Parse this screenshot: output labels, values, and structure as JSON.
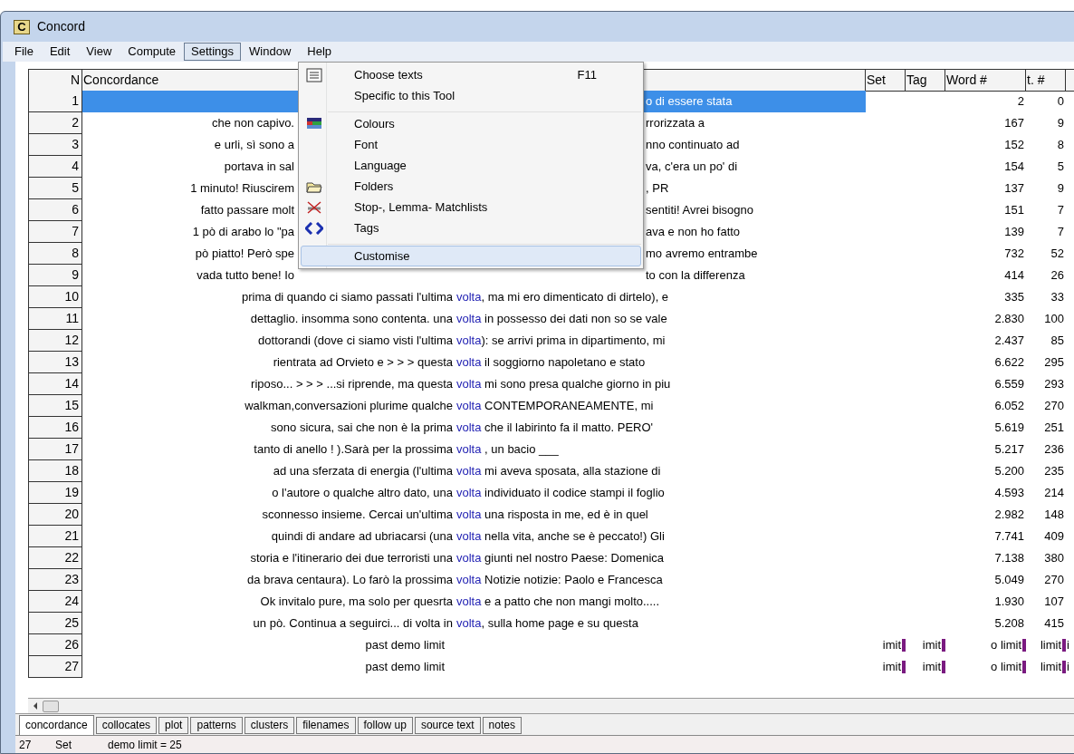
{
  "window": {
    "icon_letter": "C",
    "title": "Concord"
  },
  "menu_bar": [
    {
      "label": "File",
      "selected": false
    },
    {
      "label": "Edit",
      "selected": false
    },
    {
      "label": "View",
      "selected": false
    },
    {
      "label": "Compute",
      "selected": false
    },
    {
      "label": "Settings",
      "selected": true
    },
    {
      "label": "Window",
      "selected": false
    },
    {
      "label": "Help",
      "selected": false
    }
  ],
  "settings_menu": {
    "items": [
      {
        "kind": "item",
        "label": "Choose texts",
        "shortcut": "F11",
        "selected": false
      },
      {
        "kind": "item",
        "label": "Specific to this Tool",
        "selected": false
      },
      {
        "kind": "separator"
      },
      {
        "kind": "item",
        "label": "Colours",
        "selected": false
      },
      {
        "kind": "item",
        "label": "Font",
        "selected": false
      },
      {
        "kind": "item",
        "label": "Language",
        "selected": false
      },
      {
        "kind": "item",
        "label": "Folders",
        "selected": false
      },
      {
        "kind": "item",
        "label": "Stop-, Lemma-  Matchlists",
        "selected": false
      },
      {
        "kind": "item",
        "label": "Tags",
        "selected": false
      },
      {
        "kind": "separator"
      },
      {
        "kind": "item",
        "label": "Customise",
        "selected": true
      }
    ]
  },
  "table": {
    "columns": [
      "N",
      "Concordance",
      "Set",
      "Tag",
      "Word #",
      "t. #"
    ],
    "rows": [
      {
        "kind": "covered",
        "n": "1",
        "right": "o di essere stata",
        "word": "2",
        "t": "0",
        "selected": true
      },
      {
        "kind": "covered",
        "n": "2",
        "left": "che non capivo.",
        "right": "rrorizzata a",
        "word": "167",
        "t": "9",
        "selected": false
      },
      {
        "kind": "covered",
        "n": "3",
        "left": "e urli, sì sono a",
        "right": "nno continuato ad",
        "word": "152",
        "t": "8",
        "selected": false
      },
      {
        "kind": "covered",
        "n": "4",
        "left": "portava in sal",
        "right": "va, c'era un po' di",
        "word": "154",
        "t": "5",
        "selected": false
      },
      {
        "kind": "covered",
        "n": "5",
        "left": "1 minuto! Riuscirem",
        "right": ", PR",
        "word": "137",
        "t": "9",
        "selected": false
      },
      {
        "kind": "covered",
        "n": "6",
        "left": "fatto passare molt",
        "right": "sentiti! Avrei bisogno",
        "word": "151",
        "t": "7",
        "selected": false
      },
      {
        "kind": "covered",
        "n": "7",
        "left": "1 pò di arabo lo \"pa",
        "right": "ava e non ho fatto",
        "word": "139",
        "t": "7",
        "selected": false
      },
      {
        "kind": "covered",
        "n": "8",
        "left": "pò piatto! Però spe",
        "right": "mo avremo entrambe",
        "word": "732",
        "t": "52",
        "selected": false
      },
      {
        "kind": "covered",
        "n": "9",
        "left": "vada tutto bene! Io",
        "right": "to con la differenza",
        "word": "414",
        "t": "26",
        "selected": false
      },
      {
        "kind": "hit",
        "n": "10",
        "left": "prima di quando ci siamo passati l'ultima",
        "key": "volta",
        "right": ", ma mi ero dimenticato di dirtelo), e",
        "word": "335",
        "t": "33",
        "selected": false
      },
      {
        "kind": "hit",
        "n": "11",
        "left": "dettaglio. insomma sono contenta. una",
        "key": "volta",
        "right": " in possesso dei dati non so se vale",
        "word": "2.830",
        "t": "100",
        "selected": false
      },
      {
        "kind": "hit",
        "n": "12",
        "left": "dottorandi (dove ci siamo visti l'ultima",
        "key": "volta",
        "right": "): se arrivi prima in dipartimento, mi",
        "word": "2.437",
        "t": "85",
        "selected": false
      },
      {
        "kind": "hit",
        "n": "13",
        "left": "rientrata ad Orvieto e > > > questa",
        "key": "volta",
        "right": " il soggiorno napoletano e stato",
        "word": "6.622",
        "t": "295",
        "selected": false
      },
      {
        "kind": "hit",
        "n": "14",
        "left": "riposo... > > > ...si riprende, ma questa",
        "key": "volta",
        "right": " mi sono presa qualche giorno in piu",
        "word": "6.559",
        "t": "293",
        "selected": false
      },
      {
        "kind": "hit",
        "n": "15",
        "left": "walkman,conversazioni plurime qualche",
        "key": "volta",
        "right": " CONTEMPORANEAMENTE, mi",
        "word": "6.052",
        "t": "270",
        "selected": false
      },
      {
        "kind": "hit",
        "n": "16",
        "left": "sono sicura, sai che non è la prima",
        "key": "volta",
        "right": " che il labirinto fa il matto. PERO'",
        "word": "5.619",
        "t": "251",
        "selected": false
      },
      {
        "kind": "hit",
        "n": "17",
        "left": "tanto di anello ! ).Sarà per la prossima",
        "key": "volta",
        "right": " , un bacio ___",
        "word": "5.217",
        "t": "236",
        "selected": false
      },
      {
        "kind": "hit",
        "n": "18",
        "left": "ad una sferzata di energia (l'ultima",
        "key": "volta",
        "right": " mi aveva sposata, alla stazione di",
        "word": "5.200",
        "t": "235",
        "selected": false
      },
      {
        "kind": "hit",
        "n": "19",
        "left": "o l'autore o qualche altro dato, una",
        "key": "volta",
        "right": " individuato il codice stampi il foglio",
        "word": "4.593",
        "t": "214",
        "selected": false
      },
      {
        "kind": "hit",
        "n": "20",
        "left": "sconnesso insieme. Cercai un'ultima",
        "key": "volta",
        "right": " una risposta in me, ed è in quel",
        "word": "2.982",
        "t": "148",
        "selected": false
      },
      {
        "kind": "hit",
        "n": "21",
        "left": "quindi di andare ad ubriacarsi (una",
        "key": "volta",
        "right": " nella vita, anche se è peccato!) Gli",
        "word": "7.741",
        "t": "409",
        "selected": false
      },
      {
        "kind": "hit",
        "n": "22",
        "left": "storia e l'itinerario dei due terroristi una",
        "key": "volta",
        "right": " giunti nel nostro Paese: Domenica",
        "word": "7.138",
        "t": "380",
        "selected": false
      },
      {
        "kind": "hit",
        "n": "23",
        "left": "da brava centaura). Lo farò la prossima",
        "key": "volta",
        "right": " Notizie notizie: Paolo e Francesca",
        "word": "5.049",
        "t": "270",
        "selected": false
      },
      {
        "kind": "hit",
        "n": "24",
        "left": "Ok invitalo pure, ma solo per quesrta",
        "key": "volta",
        "right": " e a patto che non mangi molto.....",
        "word": "1.930",
        "t": "107",
        "selected": false
      },
      {
        "kind": "hit",
        "n": "25",
        "left": "un pò. Continua a seguirci... di volta in",
        "key": "volta",
        "right": ", sulla home page e su questa",
        "word": "5.208",
        "t": "415",
        "selected": false
      },
      {
        "kind": "limit",
        "n": "26",
        "text": "past demo limit",
        "set": "imit",
        "tag": "imit",
        "word": "o limit",
        "t": "limit",
        "extra": "i",
        "selected": false
      },
      {
        "kind": "limit",
        "n": "27",
        "text": "past demo limit",
        "set": "imit",
        "tag": "imit",
        "word": "o limit",
        "t": "limit",
        "extra": "i",
        "selected": false
      }
    ]
  },
  "tabs": [
    {
      "label": "concordance",
      "selected": true
    },
    {
      "label": "collocates",
      "selected": false
    },
    {
      "label": "plot",
      "selected": false
    },
    {
      "label": "patterns",
      "selected": false
    },
    {
      "label": "clusters",
      "selected": false
    },
    {
      "label": "filenames",
      "selected": false
    },
    {
      "label": "follow up",
      "selected": false
    },
    {
      "label": "source text",
      "selected": false
    },
    {
      "label": "notes",
      "selected": false
    }
  ],
  "status_bar": [
    "27",
    "Set",
    "demo limit = 25"
  ]
}
